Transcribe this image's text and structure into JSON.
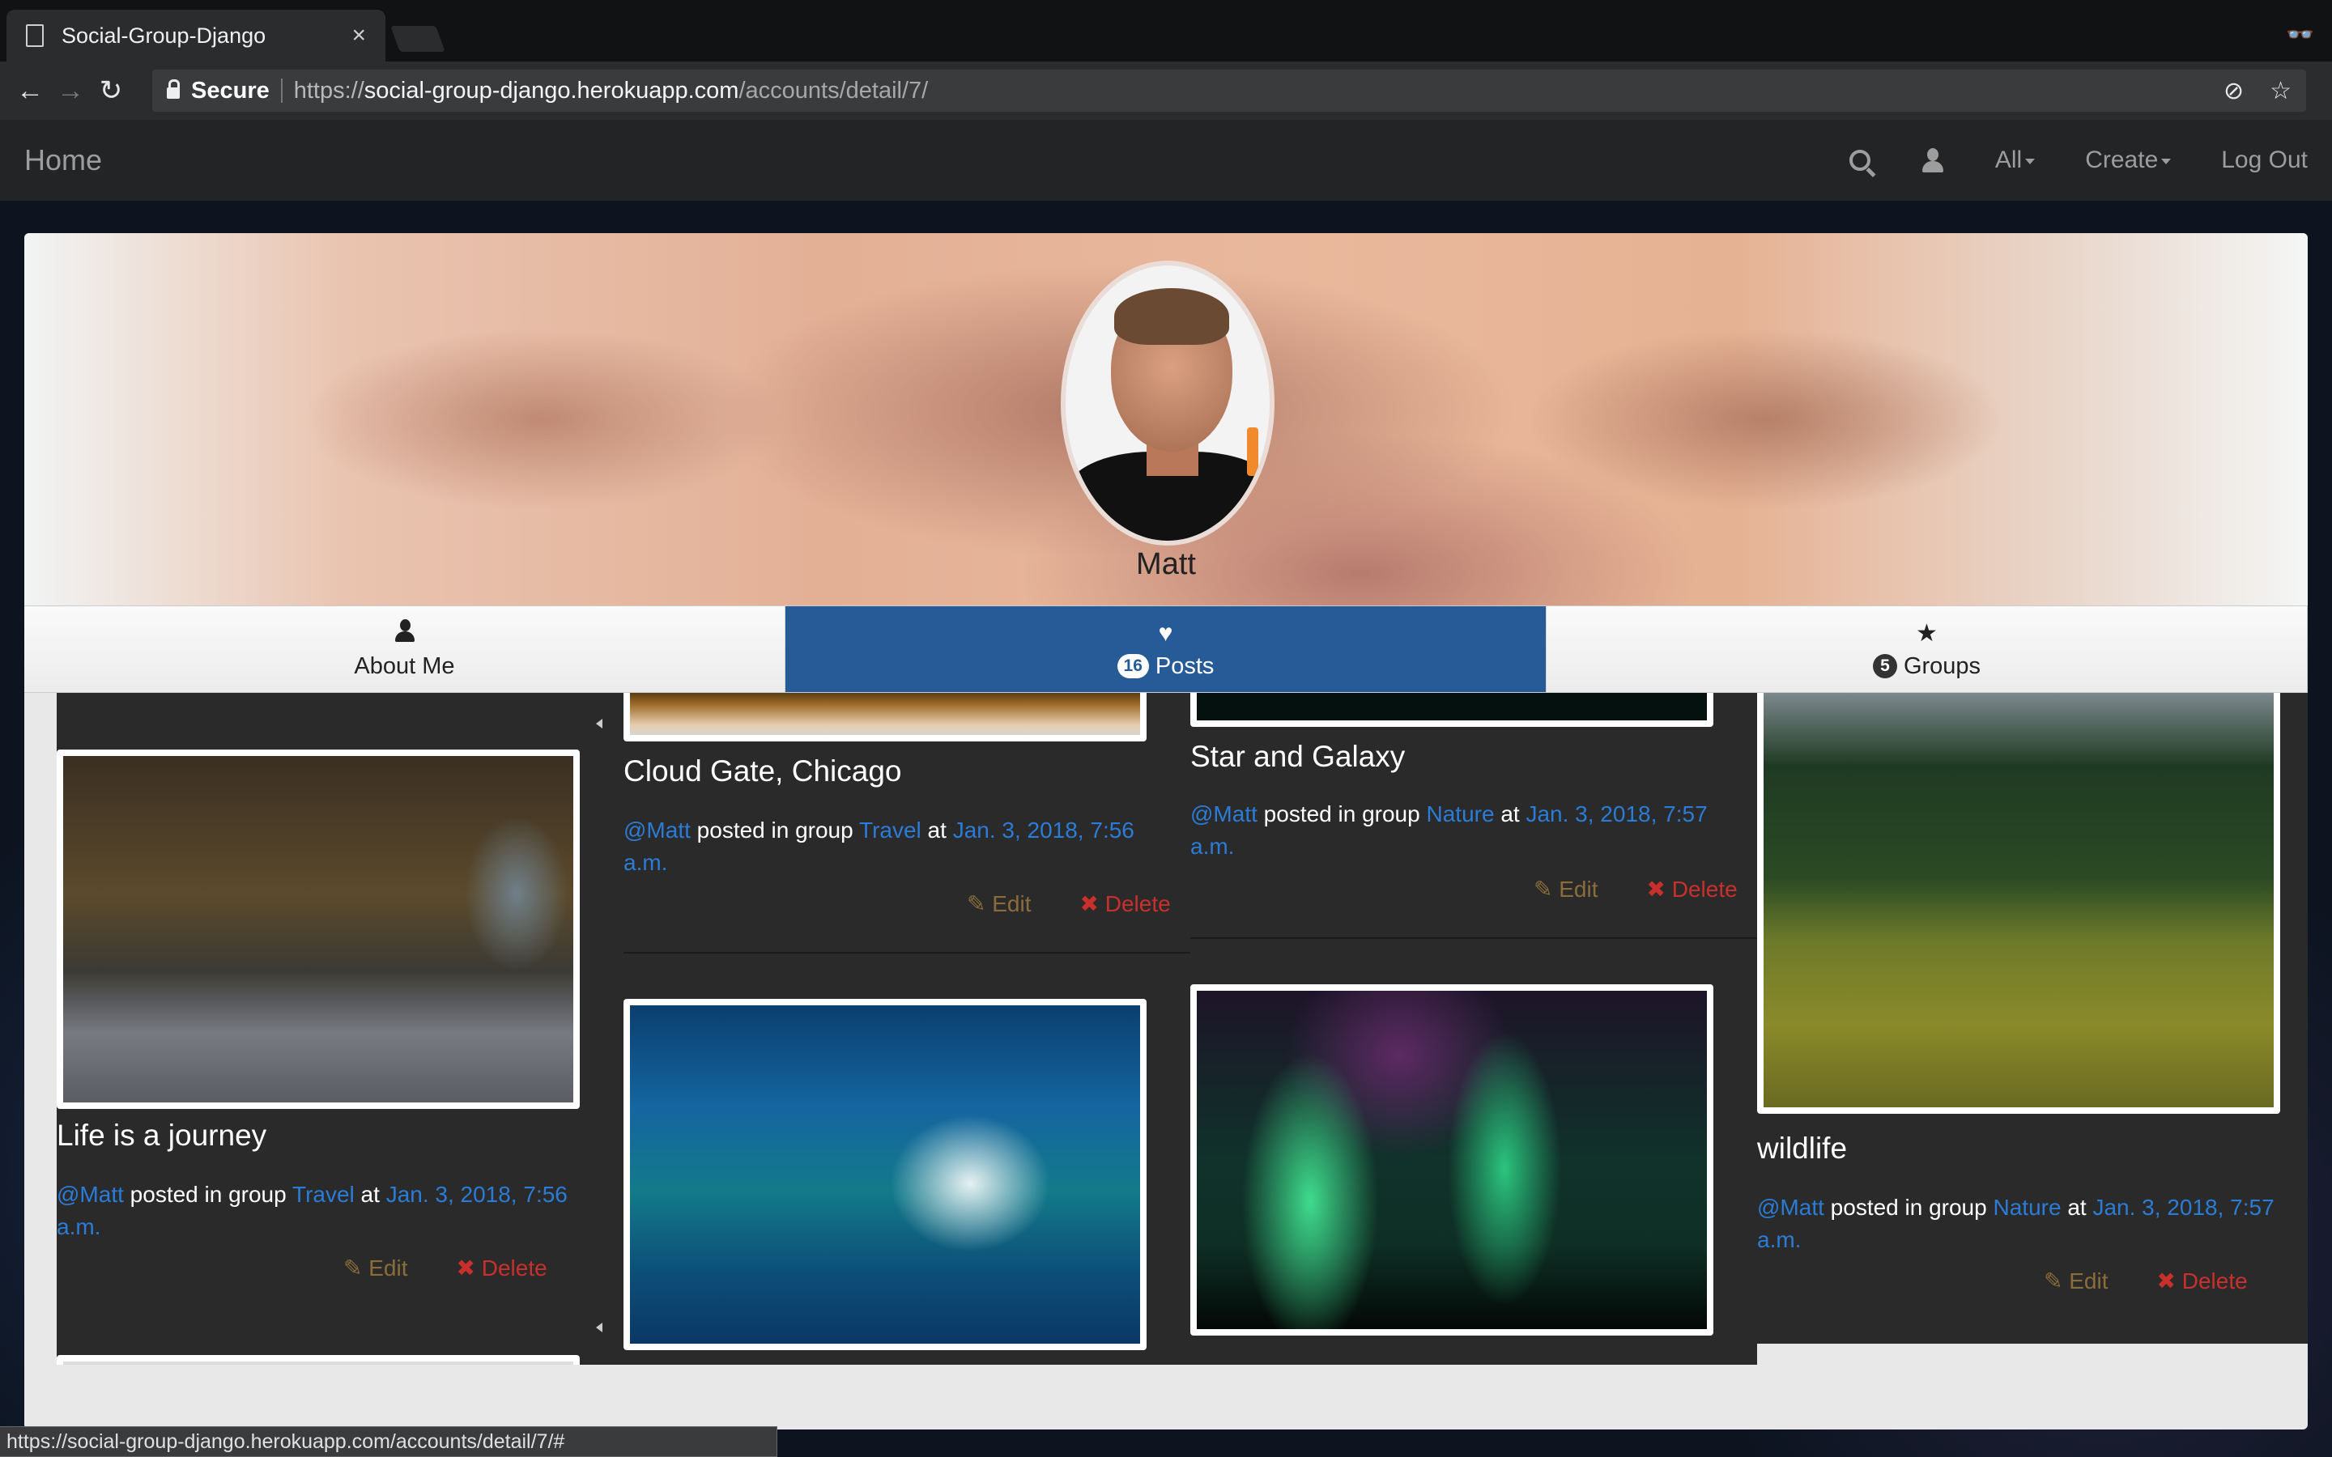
{
  "browser": {
    "tab_title": "Social-Group-Django",
    "tab_close": "×",
    "secure_label": "Secure",
    "url_scheme": "https://",
    "url_host": "social-group-django.herokuapp.com",
    "url_path": "/accounts/detail/7/",
    "status_url": "https://social-group-django.herokuapp.com/accounts/detail/7/#"
  },
  "navbar": {
    "brand": "Home",
    "all_label": "All",
    "create_label": "Create",
    "logout_label": "Log Out"
  },
  "profile": {
    "name": "Matt",
    "tabs": [
      {
        "label": "About Me",
        "icon": "user-icon"
      },
      {
        "label": "Posts",
        "count": "16",
        "icon": "heart-icon"
      },
      {
        "label": "Groups",
        "count": "5",
        "icon": "star-icon"
      }
    ]
  },
  "posts": [
    {
      "title": "Life is a journey",
      "user": "@Matt",
      "posted_in": "posted in group",
      "group": "Travel",
      "at": "at",
      "date": "Jan. 3, 2018, 7:56 a.m.",
      "edit": "Edit",
      "delete": "Delete"
    },
    {
      "title": "Cloud Gate, Chicago",
      "user": "@Matt",
      "posted_in": "posted in group",
      "group": "Travel",
      "at": "at",
      "date": "Jan. 3, 2018, 7:56 a.m.",
      "edit": "Edit",
      "delete": "Delete"
    },
    {
      "title": "Star and Galaxy",
      "user": "@Matt",
      "posted_in": "posted in group",
      "group": "Nature",
      "at": "at",
      "date": "Jan. 3, 2018, 7:57 a.m.",
      "edit": "Edit",
      "delete": "Delete"
    },
    {
      "title": "wildlife",
      "user": "@Matt",
      "posted_in": "posted in group",
      "group": "Nature",
      "at": "at",
      "date": "Jan. 3, 2018, 7:57 a.m.",
      "edit": "Edit",
      "delete": "Delete"
    }
  ]
}
